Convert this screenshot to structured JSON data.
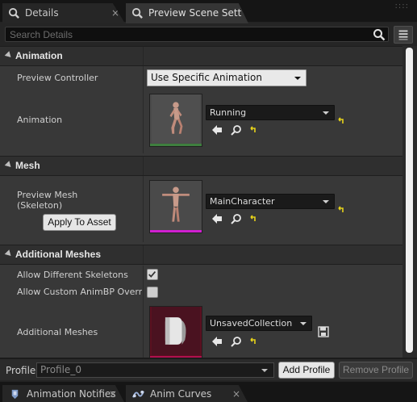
{
  "tabs": [
    {
      "label": "Details",
      "close": "×"
    },
    {
      "label": "Preview Scene Sett",
      "close": "×"
    }
  ],
  "tab_overflow": "::::",
  "search": {
    "placeholder": "Search Details",
    "value": ""
  },
  "sections": {
    "animation": {
      "title": "Animation",
      "preview_controller": {
        "label": "Preview Controller",
        "value": "Use Specific Animation"
      },
      "animation": {
        "label": "Animation",
        "value": "Running"
      }
    },
    "mesh": {
      "title": "Mesh",
      "preview_mesh": {
        "label_line1": "Preview Mesh",
        "label_line2": "(Skeleton)",
        "value": "MainCharacter"
      },
      "apply_button": "Apply To Asset"
    },
    "additional_meshes": {
      "title": "Additional Meshes",
      "allow_different_skeletons": {
        "label": "Allow Different Skeletons",
        "checked": true
      },
      "allow_custom_animbp": {
        "label": "Allow Custom AnimBP Override",
        "checked": false
      },
      "additional_meshes": {
        "label": "Additional Meshes",
        "value": "UnsavedCollection"
      }
    }
  },
  "profile": {
    "label": "Profile",
    "value": "Profile_0",
    "add_button": "Add Profile",
    "remove_button": "Remove Profile"
  },
  "bottom_tabs": [
    {
      "label": "Animation Notifies",
      "close": "×"
    },
    {
      "label": "Anim Curves",
      "close": "×"
    }
  ],
  "colors": {
    "animation_thumb_bar": "#3f7f3f",
    "mesh_thumb_bar": "#d01fd0",
    "collection_thumb_bar": "#b0104e",
    "reset_arrow": "#e6d21a"
  }
}
